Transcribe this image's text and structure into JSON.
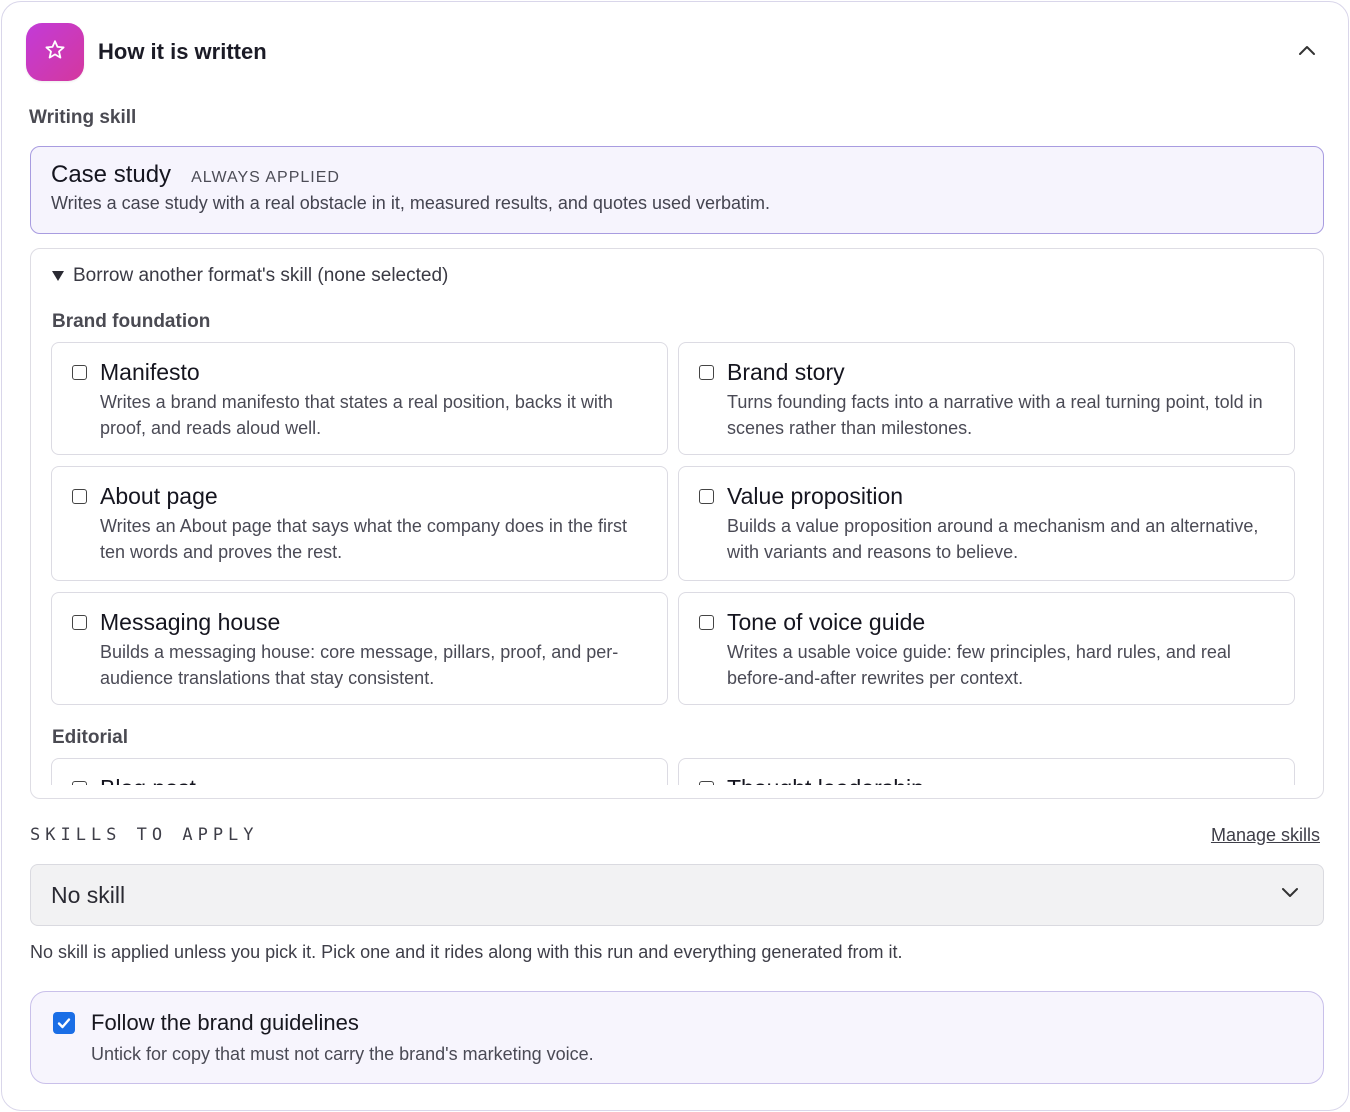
{
  "header": {
    "title": "How it is written",
    "icon": "star-icon"
  },
  "writing_skill": {
    "label": "Writing skill",
    "applied": {
      "title": "Case study",
      "badge": "ALWAYS APPLIED",
      "description": "Writes a case study with a real obstacle in it, measured results, and quotes used verbatim."
    }
  },
  "borrow": {
    "summary": "Borrow another format's skill (none selected)",
    "groups": [
      {
        "label": "Brand foundation",
        "skills": [
          {
            "title": "Manifesto",
            "description": "Writes a brand manifesto that states a real position, backs it with proof, and reads aloud well.",
            "checked": false
          },
          {
            "title": "Brand story",
            "description": "Turns founding facts into a narrative with a real turning point, told in scenes rather than milestones.",
            "checked": false
          },
          {
            "title": "About page",
            "description": "Writes an About page that says what the company does in the first ten words and proves the rest.",
            "checked": false
          },
          {
            "title": "Value proposition",
            "description": "Builds a value proposition around a mechanism and an alternative, with variants and reasons to believe.",
            "checked": false
          },
          {
            "title": "Messaging house",
            "description": "Builds a messaging house: core message, pillars, proof, and per-audience translations that stay consistent.",
            "checked": false
          },
          {
            "title": "Tone of voice guide",
            "description": "Writes a usable voice guide: few principles, hard rules, and real before-and-after rewrites per context.",
            "checked": false
          }
        ]
      },
      {
        "label": "Editorial",
        "skills": [
          {
            "title": "Blog post",
            "description": "",
            "checked": false
          },
          {
            "title": "Thought leadership",
            "description": "",
            "checked": false
          }
        ]
      }
    ]
  },
  "skills_to_apply": {
    "label": "SKILLS TO APPLY",
    "manage_link": "Manage skills",
    "select_value": "No skill",
    "help": "No skill is applied unless you pick it. Pick one and it rides along with this run and everything generated from it."
  },
  "guidelines": {
    "title": "Follow the brand guidelines",
    "description": "Untick for copy that must not carry the brand's marketing voice.",
    "checked": true
  },
  "colors": {
    "accent": "#a89ce0",
    "logo_gradient_start": "#c23bd8",
    "logo_gradient_end": "#d4389e",
    "checkbox_checked": "#1a6ee6"
  }
}
